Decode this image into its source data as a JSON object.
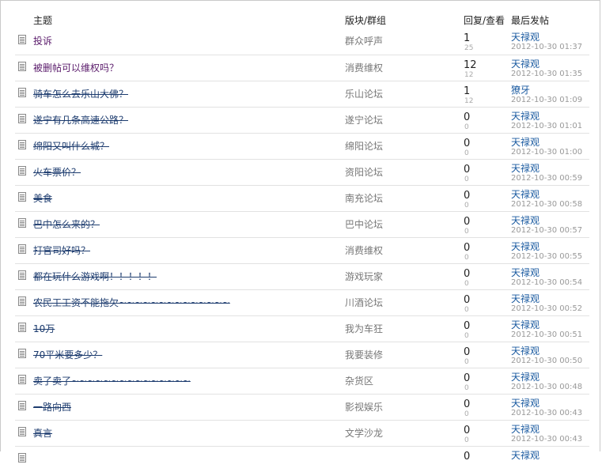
{
  "header": {
    "topic": "主题",
    "forum": "版块/群组",
    "stats": "回复/查看",
    "last_post": "最后发帖"
  },
  "rows": [
    {
      "title": "投诉",
      "forum": "群众呼声",
      "replies": "1",
      "views": "25",
      "author": "天禄观",
      "time": "2012-10-30 01:37",
      "struck": false,
      "visited": true
    },
    {
      "title": "被删帖可以维权吗？",
      "forum": "消费维权",
      "replies": "12",
      "views": "12",
      "author": "天禄观",
      "time": "2012-10-30 01:35",
      "struck": false,
      "visited": true
    },
    {
      "title": "骑车怎么去乐山大佛？",
      "forum": "乐山论坛",
      "replies": "1",
      "views": "12",
      "author": "獠牙",
      "time": "2012-10-30 01:09",
      "struck": true,
      "visited": false
    },
    {
      "title": "遂宁有几条高速公路？",
      "forum": "遂宁论坛",
      "replies": "0",
      "views": "0",
      "author": "天禄观",
      "time": "2012-10-30 01:01",
      "struck": true,
      "visited": false
    },
    {
      "title": "绵阳又叫什么城？",
      "forum": "绵阳论坛",
      "replies": "0",
      "views": "0",
      "author": "天禄观",
      "time": "2012-10-30 01:00",
      "struck": true,
      "visited": false
    },
    {
      "title": "火车票价？",
      "forum": "资阳论坛",
      "replies": "0",
      "views": "0",
      "author": "天禄观",
      "time": "2012-10-30 00:59",
      "struck": true,
      "visited": false
    },
    {
      "title": "美食",
      "forum": "南充论坛",
      "replies": "0",
      "views": "0",
      "author": "天禄观",
      "time": "2012-10-30 00:58",
      "struck": true,
      "visited": false
    },
    {
      "title": "巴中怎么来的？",
      "forum": "巴中论坛",
      "replies": "0",
      "views": "0",
      "author": "天禄观",
      "time": "2012-10-30 00:57",
      "struck": true,
      "visited": false
    },
    {
      "title": "打官司好吗？",
      "forum": "消费维权",
      "replies": "0",
      "views": "0",
      "author": "天禄观",
      "time": "2012-10-30 00:55",
      "struck": true,
      "visited": false
    },
    {
      "title": "都在玩什么游戏啊！！！！！",
      "forum": "游戏玩家",
      "replies": "0",
      "views": "0",
      "author": "天禄观",
      "time": "2012-10-30 00:54",
      "struck": true,
      "visited": false
    },
    {
      "title": "农民工工资不能拖欠~~~~~~~~~~~~~~",
      "forum": "川酒论坛",
      "replies": "0",
      "views": "0",
      "author": "天禄观",
      "time": "2012-10-30 00:52",
      "struck": true,
      "visited": false
    },
    {
      "title": "10万",
      "forum": "我为车狂",
      "replies": "0",
      "views": "0",
      "author": "天禄观",
      "time": "2012-10-30 00:51",
      "struck": true,
      "visited": false
    },
    {
      "title": "70平米要多少？",
      "forum": "我要装修",
      "replies": "0",
      "views": "0",
      "author": "天禄观",
      "time": "2012-10-30 00:50",
      "struck": true,
      "visited": false
    },
    {
      "title": "卖了卖了~~~~~~~~~~~~~~~",
      "forum": "杂货区",
      "replies": "0",
      "views": "0",
      "author": "天禄观",
      "time": "2012-10-30 00:48",
      "struck": true,
      "visited": false
    },
    {
      "title": "一路向西",
      "forum": "影视娱乐",
      "replies": "0",
      "views": "0",
      "author": "天禄观",
      "time": "2012-10-30 00:43",
      "struck": true,
      "visited": false
    },
    {
      "title": "真言",
      "forum": "文学沙龙",
      "replies": "0",
      "views": "0",
      "author": "天禄观",
      "time": "2012-10-30 00:43",
      "struck": true,
      "visited": false
    },
    {
      "title": "",
      "forum": "",
      "replies": "0",
      "views": "",
      "author": "天禄观",
      "time": "",
      "struck": true,
      "visited": false
    }
  ]
}
